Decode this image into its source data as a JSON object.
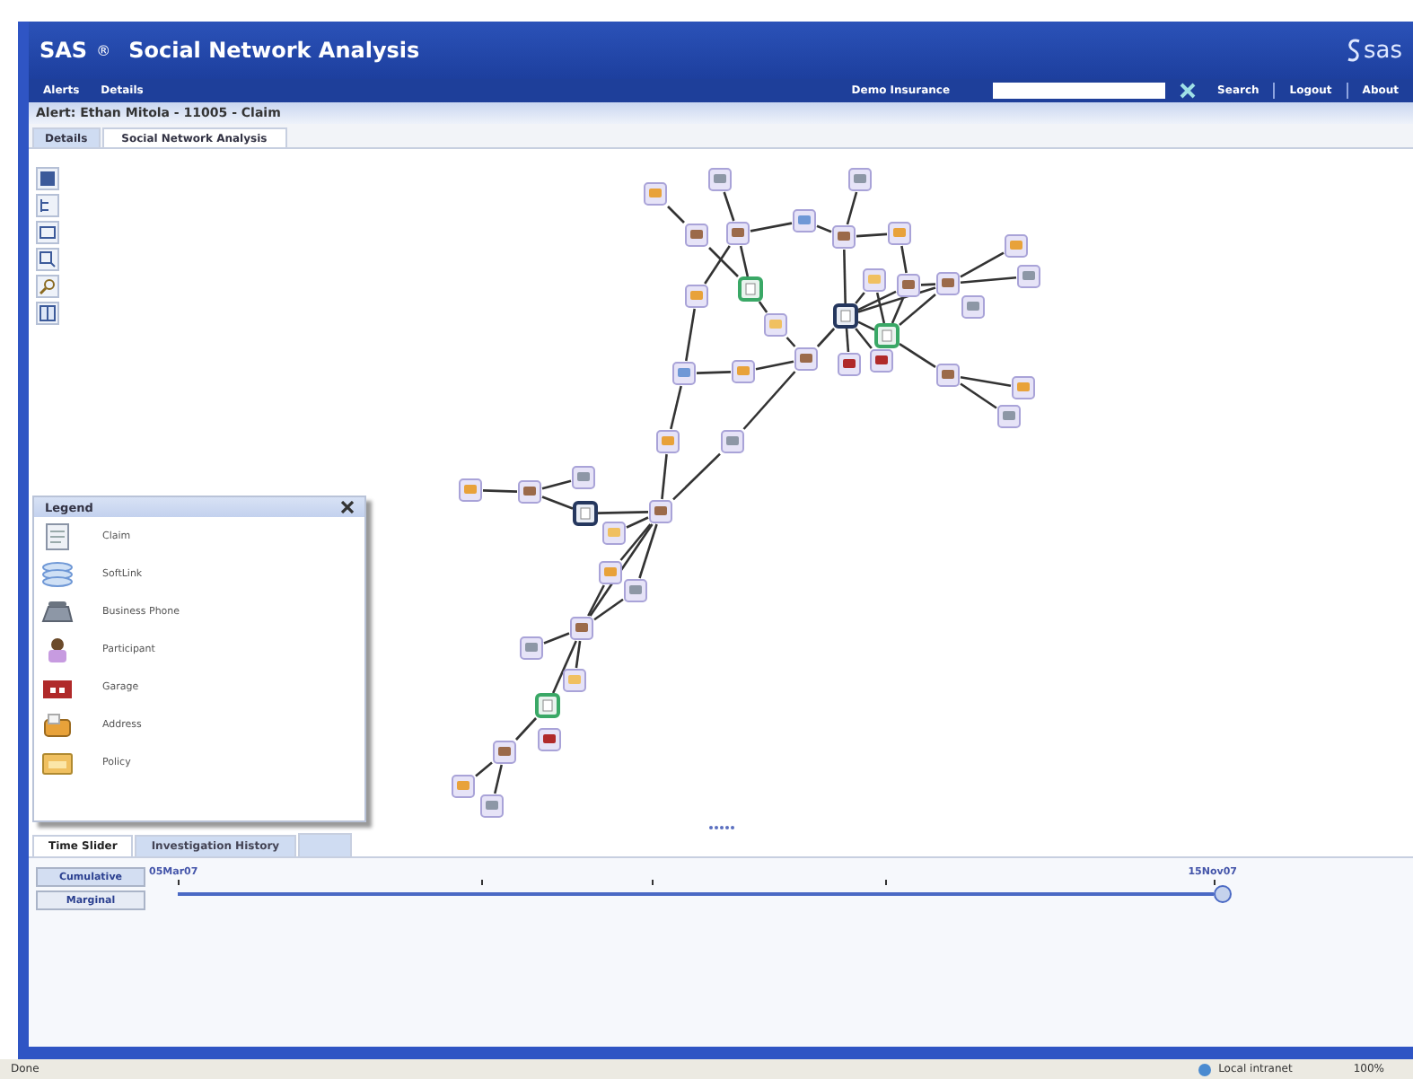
{
  "header": {
    "brand": "SAS",
    "reg": "®",
    "title": "Social Network Analysis",
    "logo": "sas"
  },
  "nav": {
    "left": [
      "Alerts",
      "Details"
    ],
    "company": "Demo Insurance",
    "search_button": "Search",
    "links": [
      "Logout",
      "About"
    ]
  },
  "alert": "Alert: Ethan Mitola - 11005 - Claim",
  "tabs": [
    {
      "label": "Details",
      "selected": false
    },
    {
      "label": "Social Network Analysis",
      "selected": true
    }
  ],
  "legend": {
    "title": "Legend",
    "items": [
      {
        "kind": "claim",
        "label": "Claim"
      },
      {
        "kind": "softlink",
        "label": "SoftLink"
      },
      {
        "kind": "phone",
        "label": "Business Phone"
      },
      {
        "kind": "participant",
        "label": "Participant"
      },
      {
        "kind": "garage",
        "label": "Garage"
      },
      {
        "kind": "address",
        "label": "Address"
      },
      {
        "kind": "policy",
        "label": "Policy"
      }
    ]
  },
  "bottom_tabs": [
    {
      "label": "Time Slider",
      "selected": true
    },
    {
      "label": "Investigation History",
      "selected": false
    }
  ],
  "modes": [
    {
      "label": "Cumulative",
      "selected": true
    },
    {
      "label": "Marginal",
      "selected": false
    }
  ],
  "slider": {
    "start": "05Mar07",
    "end": "15Nov07",
    "level": 1
  },
  "status_bar": {
    "left": "Done",
    "zone": "Local intranet",
    "zoom": "100%"
  }
}
